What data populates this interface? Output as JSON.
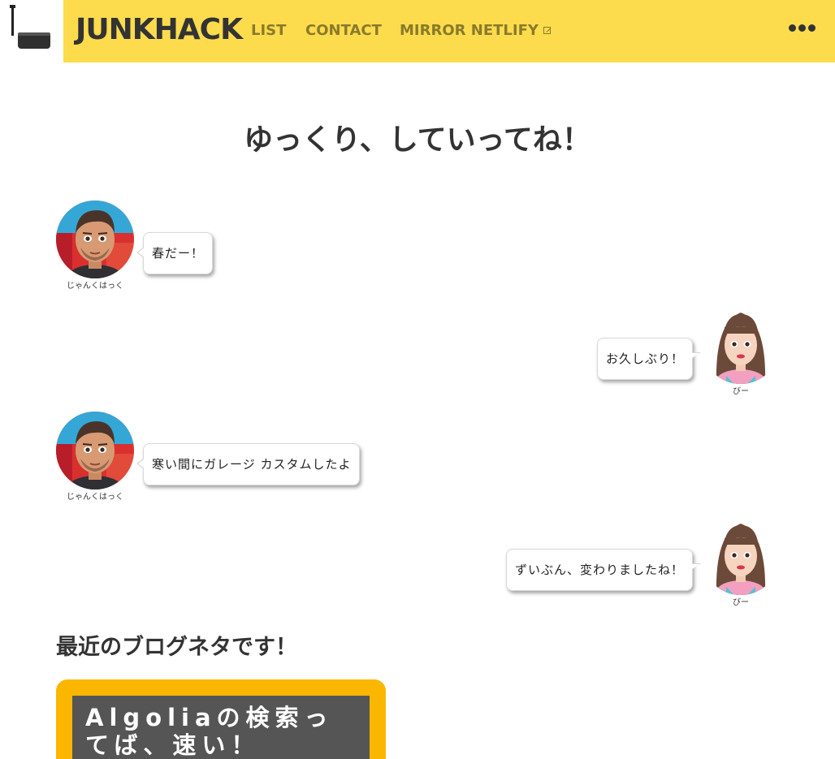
{
  "header": {
    "brand": "JUNKHACK",
    "nav": [
      {
        "label": "LIST"
      },
      {
        "label": "CONTACT"
      },
      {
        "label": "MIRROR NETLIFY"
      }
    ],
    "accent_color": "#fcdc4d",
    "more_icon": "ellipsis-icon"
  },
  "hero": {
    "title": "ゆっくり、していってね！"
  },
  "chat": [
    {
      "speaker": "じゃんくはっく",
      "side": "left",
      "text": "春だー！"
    },
    {
      "speaker": "びー",
      "side": "right",
      "text": "お久しぶり！"
    },
    {
      "speaker": "じゃんくはっく",
      "side": "left",
      "text": "寒い間にガレージ カスタムしたよ"
    },
    {
      "speaker": "びー",
      "side": "right",
      "text": "ずいぶん、変わりましたね！"
    }
  ],
  "recent": {
    "title": "最近のブログネタです！",
    "cards": [
      {
        "title": "Algoliaの検索ってば、速い！",
        "color": "#fbb600"
      }
    ]
  }
}
